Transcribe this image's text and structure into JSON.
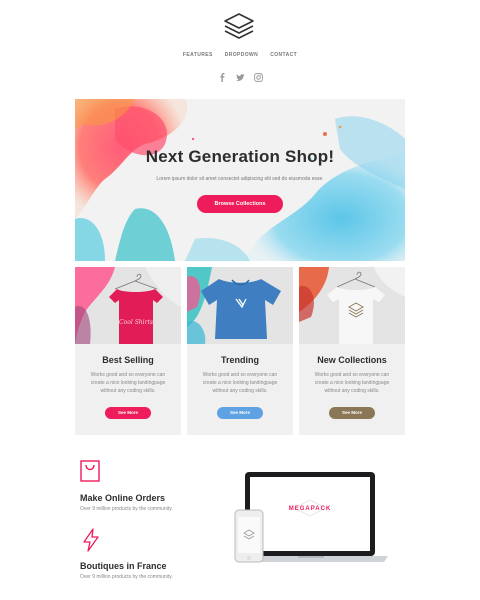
{
  "nav": {
    "items": [
      "FEATURES",
      "DROPDOWN",
      "CONTACT"
    ]
  },
  "hero": {
    "title": "Next Generation Shop!",
    "subtitle": "Lorem ipsum dolor sit amet consectet adipiscing elit sed do eiusmoda esse.",
    "button": "Browse Collections"
  },
  "cards": [
    {
      "title": "Best Selling",
      "text": "Works good and so everyone can create a nice looking landingpage without any coding skills.",
      "button": "See More",
      "button_color": "#ee1c5a",
      "shirt_text": "Cool Shirts"
    },
    {
      "title": "Trending",
      "text": "Works good and so everyone can create a nice looking landingpage without any coding skills.",
      "button": "See More",
      "button_color": "#5fa2e4"
    },
    {
      "title": "New Collections",
      "text": "Works good and so everyone can create a nice looking landingpage without any coding skills.",
      "button": "See More",
      "button_color": "#8a7755"
    }
  ],
  "features": [
    {
      "title": "Make Online Orders",
      "subtitle": "Over 9 million products by the community.",
      "icon": "shopping-bag-icon"
    },
    {
      "title": "Boutiques in France",
      "subtitle": "Over 9 million products by the community.",
      "icon": "lightning-icon"
    }
  ],
  "device": {
    "screen_text": "MEGAPACK"
  },
  "colors": {
    "accent": "#ee1c5a",
    "blue": "#5fa2e4",
    "brown": "#8a7755"
  }
}
